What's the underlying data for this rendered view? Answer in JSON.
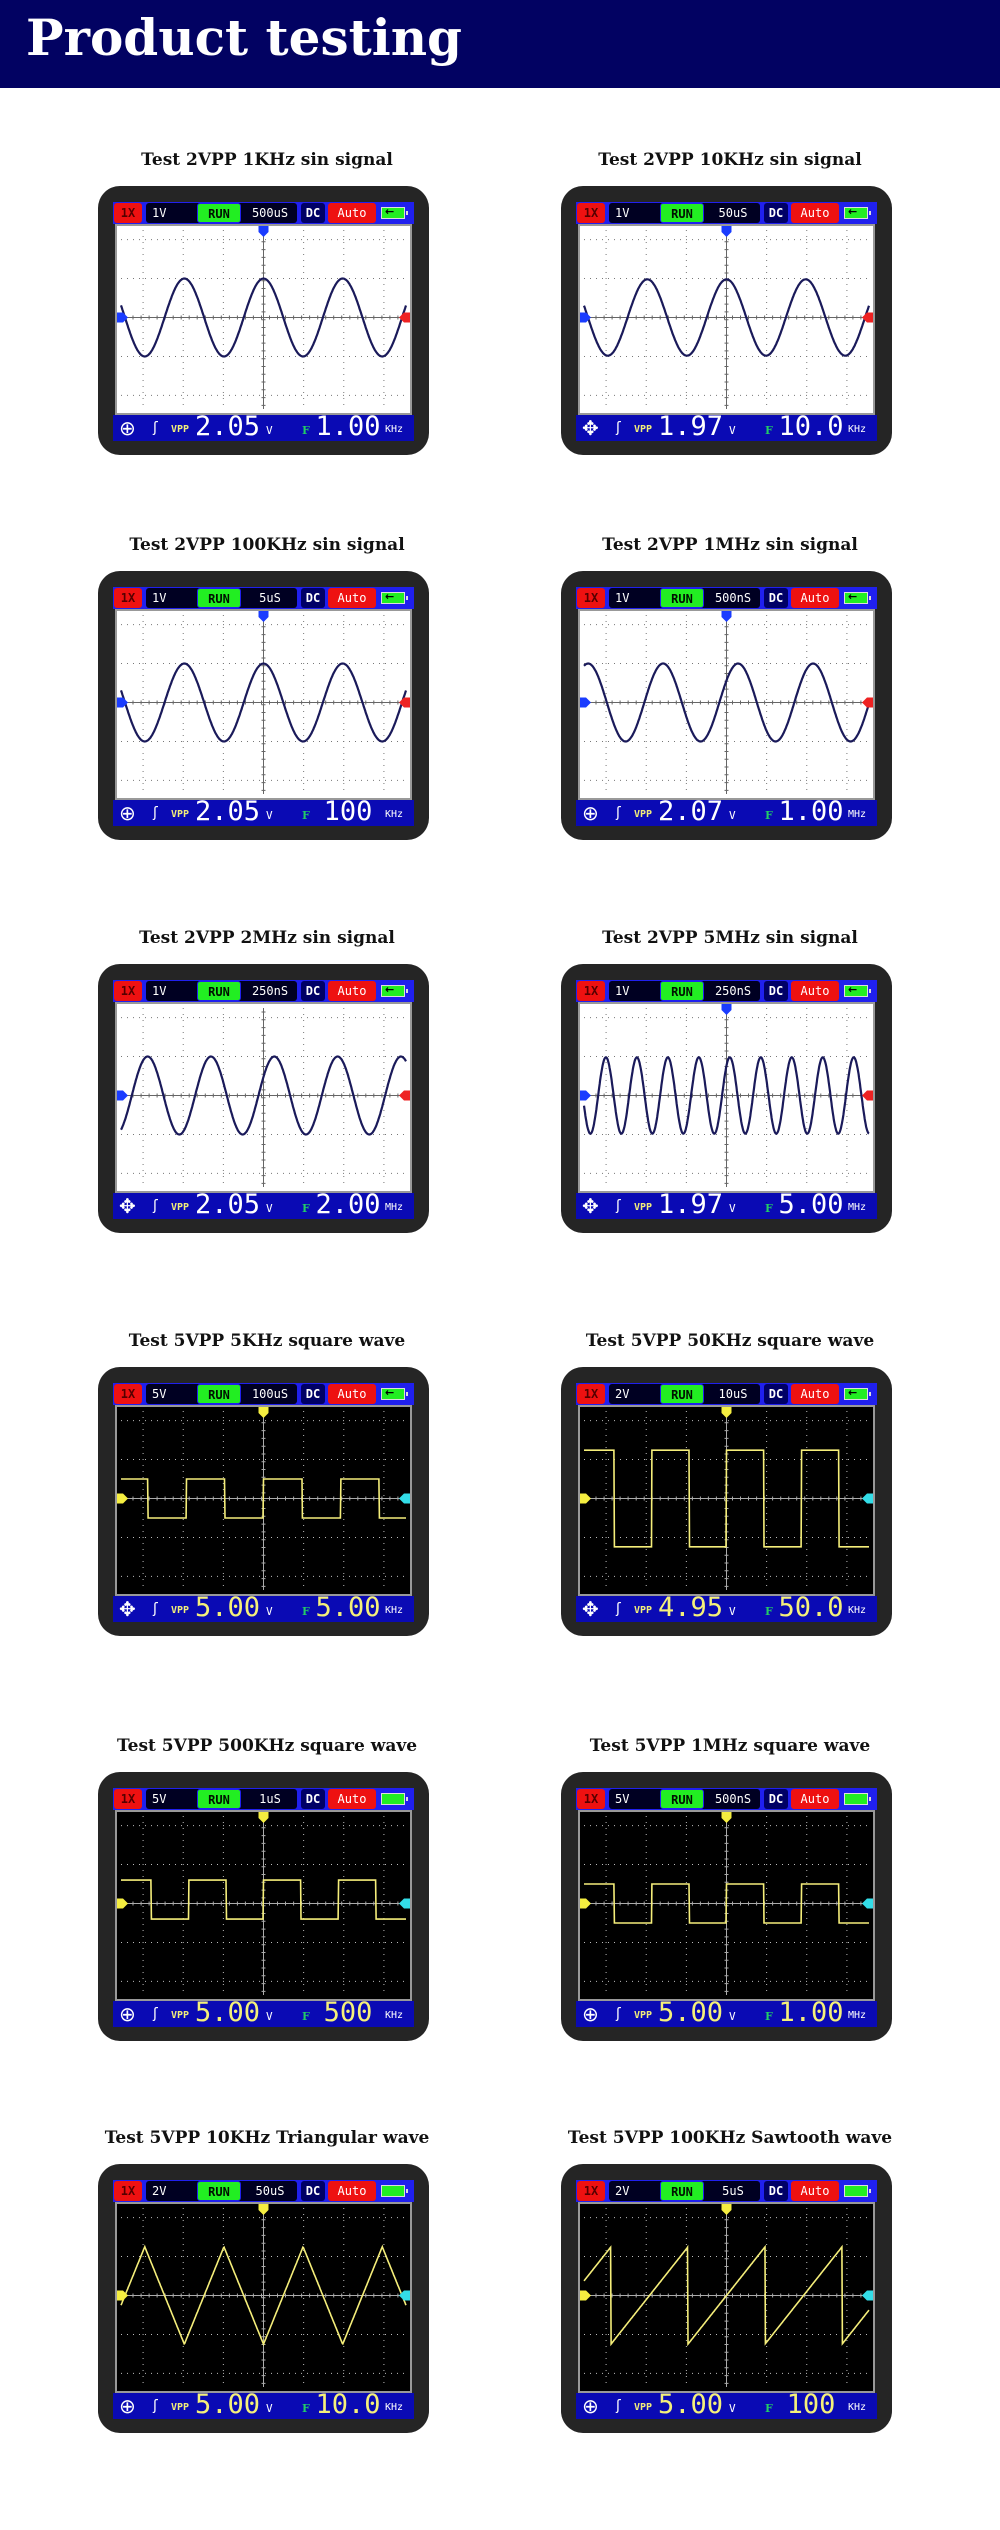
{
  "page_title": "Product testing",
  "colors": {
    "banner": "#020262",
    "sin_trace": "#1a1a5a",
    "sin_background": "#ffffff",
    "square_trace": "#f5ee7a",
    "square_background": "#000000",
    "channel_marker_blue": "#1a3cff",
    "channel_marker_red": "#ee2222",
    "channel_marker_yellow": "#f5ee40",
    "channel_marker_cyan": "#33dde8"
  },
  "tests": [
    {
      "title": "Test 2VPP 1KHz sin signal",
      "probe": "1X",
      "volts_div": "1V",
      "run_state": "RUN",
      "time_div": "500uS",
      "coupling": "DC",
      "trigger_mode": "Auto",
      "battery": "charging",
      "footer_icon": "circle-cross",
      "vpp_label": "VPP",
      "vpp": "2.05",
      "vpp_unit": "V",
      "freq_label": "F",
      "freq": "1.00",
      "freq_unit": "KHz",
      "wave": "sine",
      "theme": "light",
      "top_marker": true,
      "cycles": 3.6,
      "phase": 1.57,
      "amp_div": 1.0
    },
    {
      "title": "Test 2VPP 10KHz sin signal",
      "probe": "1X",
      "volts_div": "1V",
      "run_state": "RUN",
      "time_div": "50uS",
      "coupling": "DC",
      "trigger_mode": "Auto",
      "battery": "charging",
      "footer_icon": "move-arrows",
      "vpp_label": "VPP",
      "vpp": "1.97",
      "vpp_unit": "V",
      "freq_label": "F",
      "freq": "10.0",
      "freq_unit": "KHz",
      "wave": "sine",
      "theme": "light",
      "top_marker": true,
      "cycles": 3.6,
      "phase": 1.57,
      "amp_div": 0.98
    },
    {
      "title": "Test 2VPP 100KHz sin signal",
      "probe": "1X",
      "volts_div": "1V",
      "run_state": "RUN",
      "time_div": "5uS",
      "coupling": "DC",
      "trigger_mode": "Auto",
      "battery": "charging",
      "footer_icon": "circle-cross",
      "vpp_label": "VPP",
      "vpp": "2.05",
      "vpp_unit": "V",
      "freq_label": "F",
      "freq": "100",
      "freq_unit": "KHz",
      "wave": "sine",
      "theme": "light",
      "top_marker": true,
      "cycles": 3.6,
      "phase": 1.57,
      "amp_div": 1.0
    },
    {
      "title": "Test 2VPP 1MHz sin signal",
      "probe": "1X",
      "volts_div": "1V",
      "run_state": "RUN",
      "time_div": "500nS",
      "coupling": "DC",
      "trigger_mode": "Auto",
      "battery": "charging",
      "footer_icon": "circle-cross",
      "vpp_label": "VPP",
      "vpp": "2.07",
      "vpp_unit": "V",
      "freq_label": "F",
      "freq": "1.00",
      "freq_unit": "MHz",
      "wave": "sine",
      "theme": "light",
      "top_marker": true,
      "cycles": 3.8,
      "phase": 0.6,
      "amp_div": 1.0
    },
    {
      "title": "Test 2VPP 2MHz sin signal",
      "probe": "1X",
      "volts_div": "1V",
      "run_state": "RUN",
      "time_div": "250nS",
      "coupling": "DC",
      "trigger_mode": "Auto",
      "battery": "charging",
      "footer_icon": "move-arrows",
      "vpp_label": "VPP",
      "vpp": "2.05",
      "vpp_unit": "V",
      "freq_label": "F",
      "freq": "2.00",
      "freq_unit": "MHz",
      "wave": "sine",
      "theme": "light",
      "top_marker": false,
      "cycles": 4.5,
      "phase": 0.5,
      "amp_div": 1.0
    },
    {
      "title": "Test 2VPP 5MHz sin signal",
      "probe": "1X",
      "volts_div": "1V",
      "run_state": "RUN",
      "time_div": "250nS",
      "coupling": "DC",
      "trigger_mode": "Auto",
      "battery": "charging",
      "footer_icon": "move-arrows",
      "vpp_label": "VPP",
      "vpp": "1.97",
      "vpp_unit": "V",
      "freq_label": "F",
      "freq": "5.00",
      "freq_unit": "MHz",
      "wave": "sine",
      "theme": "light",
      "top_marker": true,
      "cycles": 9.2,
      "phase": 0.9,
      "amp_div": 0.98
    },
    {
      "title": "Test 5VPP 5KHz square wave",
      "probe": "1X",
      "volts_div": "5V",
      "run_state": "RUN",
      "time_div": "100uS",
      "coupling": "DC",
      "trigger_mode": "Auto",
      "battery": "charging",
      "footer_icon": "move-arrows",
      "vpp_label": "VPP",
      "vpp": "5.00",
      "vpp_unit": "V",
      "freq_label": "F",
      "freq": "5.00",
      "freq_unit": "KHz",
      "wave": "square",
      "theme": "dark",
      "top_marker": true,
      "cycles": 3.7,
      "phase": 0.0,
      "amp_div": 0.5,
      "offset_div": 0.0
    },
    {
      "title": "Test 5VPP 50KHz square wave",
      "probe": "1X",
      "volts_div": "2V",
      "run_state": "RUN",
      "time_div": "10uS",
      "coupling": "DC",
      "trigger_mode": "Auto",
      "battery": "charging",
      "footer_icon": "move-arrows",
      "vpp_label": "VPP",
      "vpp": "4.95",
      "vpp_unit": "V",
      "freq_label": "F",
      "freq": "50.0",
      "freq_unit": "KHz",
      "wave": "square",
      "theme": "dark",
      "top_marker": true,
      "cycles": 3.8,
      "phase": 0.0,
      "amp_div": 1.24,
      "offset_div": 0.0
    },
    {
      "title": "Test 5VPP 500KHz square wave",
      "probe": "1X",
      "volts_div": "5V",
      "run_state": "RUN",
      "time_div": "1uS",
      "coupling": "DC",
      "trigger_mode": "Auto",
      "battery": "full",
      "footer_icon": "circle-cross",
      "vpp_label": "VPP",
      "vpp": "5.00",
      "vpp_unit": "V",
      "freq_label": "F",
      "freq": "500",
      "freq_unit": "KHz",
      "wave": "square",
      "theme": "dark",
      "top_marker": true,
      "cycles": 3.8,
      "phase": 0.0,
      "amp_div": 0.5,
      "offset_div": 0.1
    },
    {
      "title": "Test 5VPP 1MHz square wave",
      "probe": "1X",
      "volts_div": "5V",
      "run_state": "RUN",
      "time_div": "500nS",
      "coupling": "DC",
      "trigger_mode": "Auto",
      "battery": "full",
      "footer_icon": "circle-cross",
      "vpp_label": "VPP",
      "vpp": "5.00",
      "vpp_unit": "V",
      "freq_label": "F",
      "freq": "1.00",
      "freq_unit": "MHz",
      "wave": "square",
      "theme": "dark",
      "top_marker": true,
      "cycles": 3.8,
      "phase": 0.0,
      "amp_div": 0.5,
      "offset_div": 0.0
    },
    {
      "title": "Test 5VPP 10KHz Triangular wave",
      "probe": "1X",
      "volts_div": "2V",
      "run_state": "RUN",
      "time_div": "50uS",
      "coupling": "DC",
      "trigger_mode": "Auto",
      "battery": "full",
      "footer_icon": "circle-cross",
      "vpp_label": "VPP",
      "vpp": "5.00",
      "vpp_unit": "V",
      "freq_label": "F",
      "freq": "10.0",
      "freq_unit": "KHz",
      "wave": "triangle",
      "theme": "dark",
      "top_marker": true,
      "cycles": 3.6,
      "phase": 0.0,
      "amp_div": 1.25
    },
    {
      "title": "Test 5VPP 100KHz Sawtooth wave",
      "probe": "1X",
      "volts_div": "2V",
      "run_state": "RUN",
      "time_div": "5uS",
      "coupling": "DC",
      "trigger_mode": "Auto",
      "battery": "full",
      "footer_icon": "circle-cross",
      "vpp_label": "VPP",
      "vpp": "5.00",
      "vpp_unit": "V",
      "freq_label": "F",
      "freq": "100",
      "freq_unit": "KHz",
      "wave": "sawtooth",
      "theme": "dark",
      "top_marker": true,
      "cycles": 3.7,
      "phase": 0.0,
      "amp_div": 1.25
    }
  ]
}
